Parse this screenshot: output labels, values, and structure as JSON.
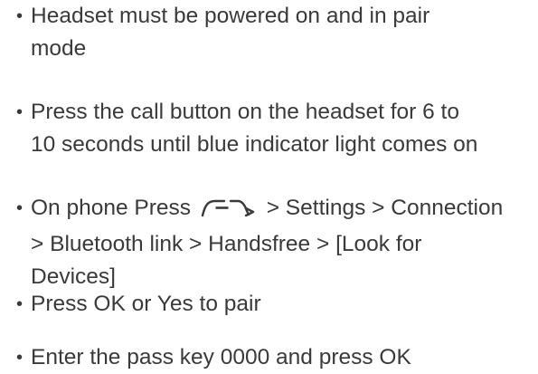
{
  "instructions": [
    {
      "lines": [
        "Headset must be powered on and in pair",
        "mode"
      ]
    },
    {
      "lines": [
        "Press the call button on the headset for 6 to",
        "10 seconds until blue indicator light comes on"
      ]
    },
    {
      "prefix": "On phone Press",
      "icon": "menu-key-icon",
      "suffix": "> Settings > Connection",
      "lines": [
        "> Bluetooth link > Handsfree > [Look for",
        "Devices]"
      ]
    },
    {
      "lines": [
        "Press OK or Yes to pair"
      ]
    },
    {
      "lines": [
        "Enter the pass key 0000 and press OK"
      ]
    }
  ],
  "bullet": "•"
}
